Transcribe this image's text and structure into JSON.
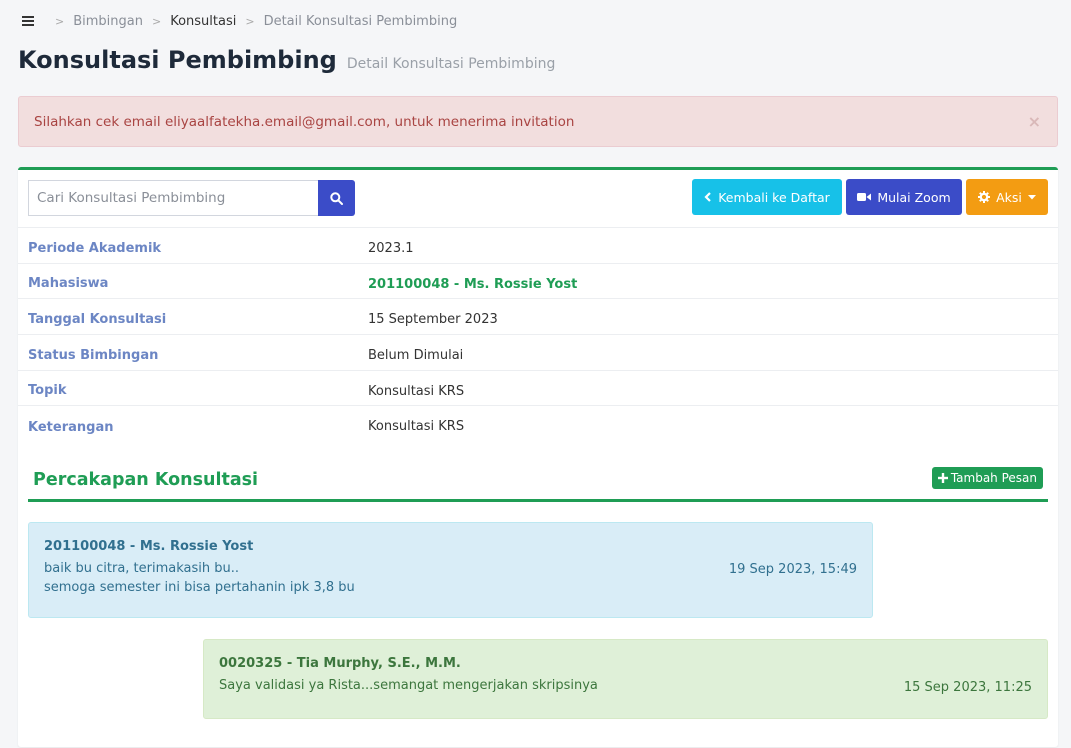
{
  "breadcrumb": {
    "items": [
      "Bimbingan",
      "Konsultasi",
      "Detail Konsultasi Pembimbing"
    ]
  },
  "page": {
    "title": "Konsultasi Pembimbing",
    "subtitle": "Detail Konsultasi Pembimbing"
  },
  "alert": {
    "message": "Silahkan cek email eliyaalfatekha.email@gmail.com, untuk menerima invitation",
    "close_label": "×"
  },
  "toolbar": {
    "search_placeholder": "Cari Konsultasi Pembimbing",
    "back_label": "Kembali ke Daftar",
    "zoom_label": "Mulai Zoom",
    "action_label": "Aksi"
  },
  "details": {
    "period_label": "Periode Akademik",
    "period_value": "2023.1",
    "student_label": "Mahasiswa",
    "student_value": "201100048 - Ms. Rossie Yost",
    "date_label": "Tanggal Konsultasi",
    "date_value": "15 September 2023",
    "status_label": "Status Bimbingan",
    "status_value": "Belum Dimulai",
    "topic_label": "Topik",
    "topic_value": "Konsultasi KRS",
    "note_label": "Keterangan",
    "note_value": "Konsultasi KRS"
  },
  "conversation": {
    "title": "Percakapan Konsultasi",
    "add_label": "Tambah Pesan",
    "messages": [
      {
        "sender": "201100048 - Ms. Rossie Yost",
        "lines": [
          "baik bu citra, terimakasih bu..",
          "semoga semester ini bisa pertahanin ipk 3,8 bu"
        ],
        "time": "19 Sep 2023, 15:49"
      },
      {
        "sender": "0020325 - Tia Murphy, S.E., M.M.",
        "lines": [
          "Saya validasi ya Rista...semangat mengerjakan skripsinya"
        ],
        "time": "15 Sep 2023, 11:25"
      }
    ]
  },
  "colors": {
    "primary": "#3b4cc8",
    "info": "#17c1e8",
    "warning": "#f39c12",
    "success": "#1f9d55",
    "danger_bg": "#f2dede"
  }
}
